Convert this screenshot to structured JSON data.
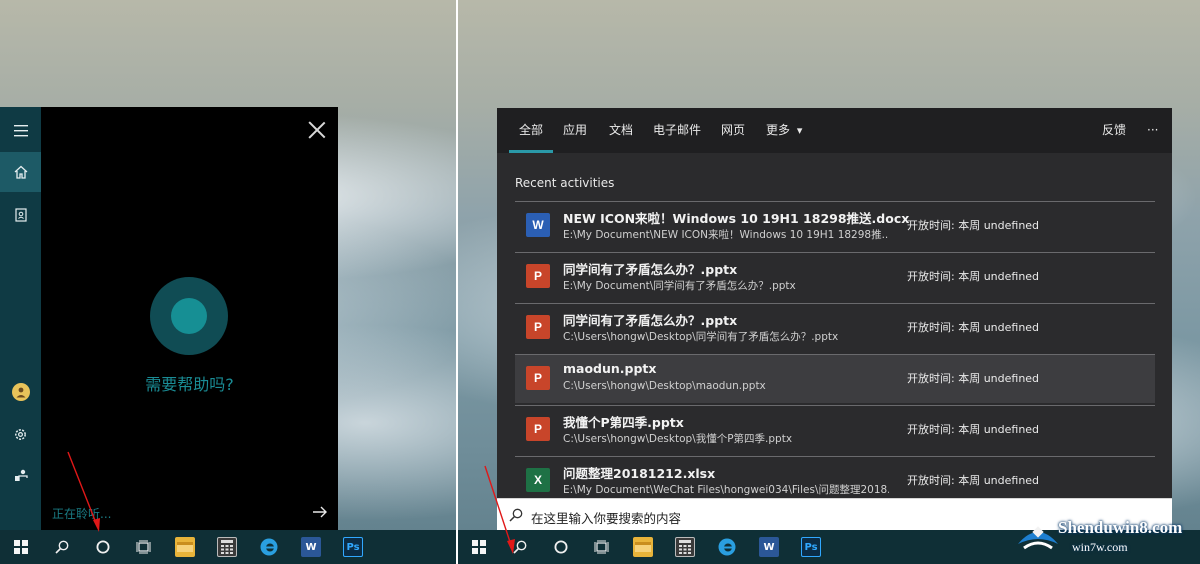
{
  "left": {
    "cortana": {
      "help_text": "需要帮助吗?",
      "listening_text": "正在聆听...",
      "rail_icons": [
        "hamburger-icon",
        "home-icon",
        "notebook-icon",
        "avatar-icon",
        "gear-icon",
        "feedback-icon"
      ]
    }
  },
  "right": {
    "tabs": [
      {
        "label": "全部",
        "active": true
      },
      {
        "label": "应用"
      },
      {
        "label": "文档"
      },
      {
        "label": "电子邮件"
      },
      {
        "label": "网页"
      },
      {
        "label": "更多"
      }
    ],
    "feedback_label": "反馈",
    "more_options": "···",
    "more_chevron": "▾",
    "section_title": "Recent activities",
    "items": [
      {
        "type": "word",
        "name": "NEW ICON来啦！Windows 10 19H1 18298推送.docx",
        "path": "E:\\My Document\\NEW ICON来啦！Windows 10 19H1 18298推...",
        "time": "开放时间: 本周 undefined"
      },
      {
        "type": "ppt",
        "name": "同学间有了矛盾怎么办？.pptx",
        "path": "E:\\My Document\\同学间有了矛盾怎么办？.pptx",
        "time": "开放时间: 本周 undefined"
      },
      {
        "type": "ppt",
        "name": "同学间有了矛盾怎么办？.pptx",
        "path": "C:\\Users\\hongw\\Desktop\\同学间有了矛盾怎么办？.pptx",
        "time": "开放时间: 本周 undefined"
      },
      {
        "type": "ppt",
        "name": "maodun.pptx",
        "path": "C:\\Users\\hongw\\Desktop\\maodun.pptx",
        "time": "开放时间: 本周 undefined",
        "highlighted": true
      },
      {
        "type": "ppt",
        "name": "我懂个P第四季.pptx",
        "path": "C:\\Users\\hongw\\Desktop\\我懂个P第四季.pptx",
        "time": "开放时间: 本周 undefined"
      },
      {
        "type": "excel",
        "name": "问题整理20181212.xlsx",
        "path": "E:\\My Document\\WeChat Files\\hongwei034\\Files\\问题整理2018...",
        "time": "开放时间: 本周 undefined"
      }
    ],
    "search_placeholder": "在这里输入你要搜索的内容"
  },
  "taskbar_apps": [
    {
      "name": "file-explorer-icon",
      "color": "#e8b43a",
      "glyph": "▭"
    },
    {
      "name": "calculator-icon",
      "color": "#3a3a3a",
      "glyph": "▦"
    },
    {
      "name": "edge-icon",
      "color": "#1e8fd6",
      "glyph": "e"
    },
    {
      "name": "word-icon",
      "color": "#2b5797",
      "glyph": "W"
    },
    {
      "name": "photoshop-icon",
      "color": "#0b2c45",
      "glyph": "Ps"
    }
  ],
  "icon_colors": {
    "word": "#2b5fb4",
    "ppt": "#c8452a",
    "excel": "#1e7145"
  },
  "watermark": {
    "title": "Shenduwin8.com",
    "subtitle": "win7w.com"
  }
}
